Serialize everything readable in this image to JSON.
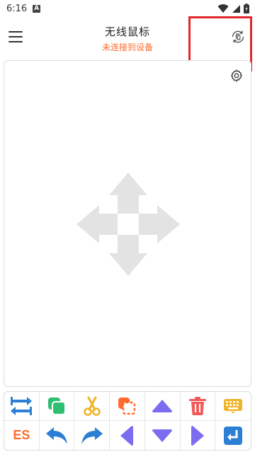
{
  "status_bar": {
    "time": "6:16",
    "notification_icon": "a-letter-icon",
    "icons": [
      "wifi-icon",
      "cell-signal-icon",
      "battery-charging-icon"
    ]
  },
  "app_bar": {
    "title": "无线鼠标",
    "subtitle": "未连接到设备",
    "menu_icon": "hamburger-menu-icon",
    "sync_icon": "connect-device-icon"
  },
  "annotation": {
    "box_color": "#e2262b",
    "arrow_color": "#e2262b"
  },
  "touchpad": {
    "settings_icon": "gear-icon",
    "center_icon": "move-cross-icon"
  },
  "toolbar": {
    "row1": [
      "switch-icon",
      "copy-icon",
      "cut-icon",
      "select-all-icon",
      "arrow-up-icon",
      "delete-icon",
      "keyboard-icon"
    ],
    "row2_es_label": "ES",
    "row2": [
      "esc-button",
      "undo-icon",
      "redo-icon",
      "arrow-left-icon",
      "arrow-down-icon",
      "arrow-right-icon",
      "enter-icon"
    ]
  },
  "colors": {
    "accent_orange": "#ff6b2c",
    "blue": "#2b7fd4",
    "green": "#2fbf71",
    "purple": "#7b6cf0",
    "red": "#f05a5a",
    "yellow": "#f0b429"
  }
}
